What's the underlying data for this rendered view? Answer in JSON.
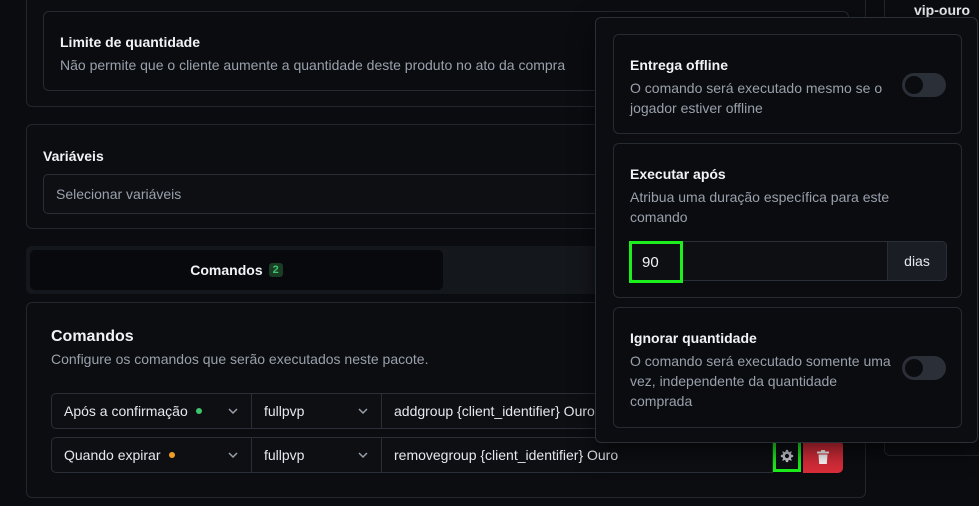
{
  "limit": {
    "title": "Limite de quantidade",
    "description": "Não permite que o cliente aumente a quantidade deste produto no ato da compra"
  },
  "variables": {
    "label": "Variáveis",
    "placeholder": "Selecionar variáveis"
  },
  "tabs": [
    {
      "label": "Comandos",
      "count": "2",
      "active": true
    }
  ],
  "commands": {
    "title": "Comandos",
    "description": "Configure os comandos que serão executados neste pacote.",
    "rows": [
      {
        "trigger": "Após a confirmação",
        "trigger_color": "#3ec46d",
        "server": "fullpvp",
        "command": "addgroup {client_identifier} Ouro"
      },
      {
        "trigger": "Quando expirar",
        "trigger_color": "#f0a020",
        "server": "fullpvp",
        "command": "removegroup {client_identifier} Ouro"
      }
    ]
  },
  "side": {
    "tag": "vip-ouro"
  },
  "popover": {
    "offline": {
      "title": "Entrega offline",
      "description": "O comando será executado mesmo se o jogador estiver offline",
      "enabled": false
    },
    "delay": {
      "title": "Executar após",
      "description": "Atribua uma duração específica para este comando",
      "value": "90",
      "unit": "dias"
    },
    "ignore_qty": {
      "title": "Ignorar quantidade",
      "description": "O comando será executado somente uma vez, independente da quantidade comprada",
      "enabled": false
    }
  },
  "colors": {
    "highlight": "#1cf01c",
    "delete": "#d92d3a",
    "accent_green": "#3ec46d"
  }
}
